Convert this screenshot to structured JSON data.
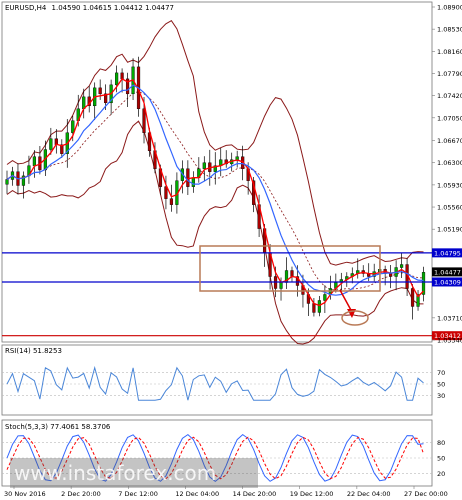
{
  "chart_data": {
    "type": "candlestick",
    "symbol": "EURUSD,H4",
    "header_values": "1.04590 1.04615 1.04412 1.04477",
    "y_ticks": [
      "1.08900",
      "1.08530",
      "1.08160",
      "1.07790",
      "1.07420",
      "1.07050",
      "1.06670",
      "1.06300",
      "1.05930",
      "1.05560",
      "1.05190",
      "1.04795",
      "1.04477",
      "1.04309",
      "1.03710",
      "1.03412",
      "1.03340"
    ],
    "ylim": [
      1.0334,
      1.0895
    ],
    "levels": [
      {
        "label": "1.04795",
        "price": 1.04795,
        "color": "#0000cc"
      },
      {
        "label": "1.04309",
        "price": 1.04309,
        "color": "#0000cc"
      },
      {
        "label": "1.03412",
        "price": 1.03412,
        "color": "#cc0000"
      }
    ],
    "current_price": {
      "label": "1.04477",
      "price": 1.04477
    },
    "x_labels": [
      "30 Nov 2016",
      "2 Dec 20:00",
      "7 Dec 12:00",
      "12 Dec 04:00",
      "14 Dec 20:00",
      "19 Dec 12:00",
      "22 Dec 04:00",
      "27 Dec 00:00"
    ],
    "close_path": [
      1.0602,
      1.0615,
      1.0592,
      1.0608,
      1.0625,
      1.064,
      1.0618,
      1.0652,
      1.067,
      1.066,
      1.0645,
      1.068,
      1.07,
      1.072,
      1.074,
      1.0725,
      1.0755,
      1.0745,
      1.073,
      1.076,
      1.078,
      1.077,
      1.0745,
      1.079,
      1.072,
      1.068,
      1.065,
      1.062,
      1.059,
      1.057,
      1.056,
      1.06,
      1.062,
      1.059,
      1.0605,
      1.062,
      1.063,
      1.0615,
      1.0625,
      1.0635,
      1.0628,
      1.0635,
      1.064,
      1.062,
      1.06,
      1.056,
      1.052,
      1.048,
      1.044,
      1.042,
      1.043,
      1.045,
      1.044,
      1.0425,
      1.041,
      1.0395,
      1.038,
      1.04,
      1.041,
      1.042,
      1.043,
      1.0435,
      1.044,
      1.0445,
      1.045,
      1.0445,
      1.044,
      1.0448,
      1.0452,
      1.0445,
      1.044,
      1.0455,
      1.046,
      1.042,
      1.039,
      1.041,
      1.0447
    ],
    "rsi": {
      "label": "RSI(14) 51.8253",
      "levels": [
        "70",
        "50",
        "30"
      ],
      "current": 51.8253
    },
    "stoch": {
      "label": "Stoch(5,3,3) 77.4061 58.3706",
      "levels": [
        "80",
        "50",
        "20"
      ],
      "main": 77.4061,
      "signal": 58.3706
    },
    "watermark": "www.instaforex.com",
    "colors": {
      "bull": "#00aa00",
      "bear": "#aa0000",
      "ma_red": "#ff0000",
      "ma_blue": "#3366ff",
      "band": "#8b1a1a",
      "box": "#b97a57",
      "rsi": "#4a86d8"
    }
  }
}
